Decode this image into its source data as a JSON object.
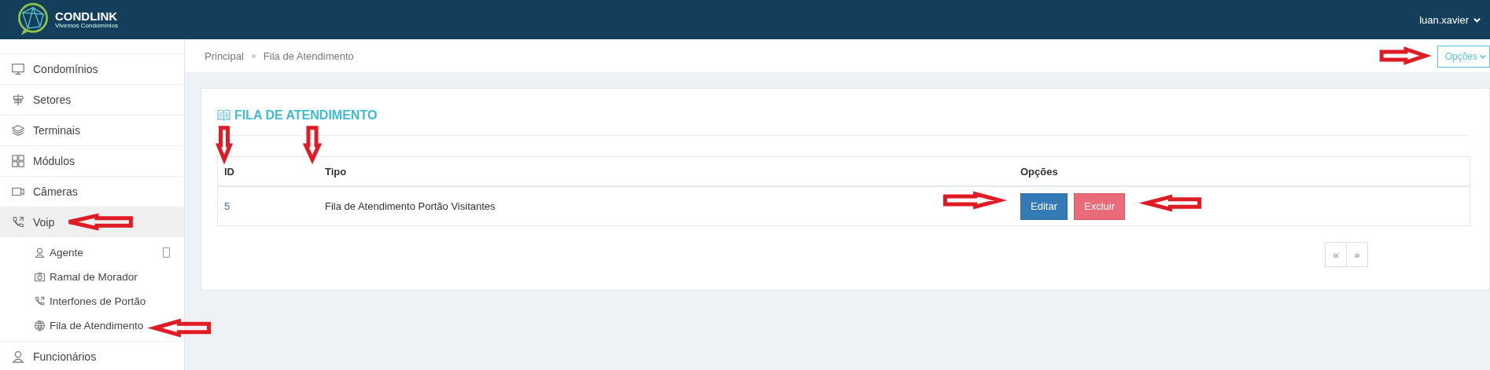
{
  "header": {
    "brand": "CONDLINK",
    "tagline": "Vivemos Condomínios",
    "user": "luan.xavier"
  },
  "sidebar": {
    "items": [
      {
        "label": "Condomínios",
        "kind": "monitor",
        "selected": false
      },
      {
        "label": "Setores",
        "kind": "sign",
        "selected": false
      },
      {
        "label": "Terminais",
        "kind": "layers",
        "selected": false
      },
      {
        "label": "Módulos",
        "kind": "grid",
        "selected": false
      },
      {
        "label": "Câmeras",
        "kind": "camera",
        "selected": false
      },
      {
        "label": "Voip",
        "kind": "phone",
        "selected": true,
        "children": [
          {
            "label": "Agente",
            "kind": "user"
          },
          {
            "label": "Ramal de Morador",
            "kind": "photo"
          },
          {
            "label": "Interfones de Portão",
            "kind": "phone"
          },
          {
            "label": "Fila de Atendimento",
            "kind": "globe"
          }
        ]
      },
      {
        "label": "Funcionários",
        "kind": "user",
        "selected": false
      }
    ]
  },
  "breadcrumb": [
    "Principal",
    "Fila de Atendimento"
  ],
  "options_button": "Opções",
  "panel": {
    "title": "FILA DE ATENDIMENTO",
    "table": {
      "columns": [
        "ID",
        "Tipo",
        "Opções"
      ],
      "rows": [
        {
          "id": "5",
          "tipo": "Fila de Atendimento Portão Visitantes",
          "actions": [
            "Editar",
            "Excluir"
          ]
        }
      ]
    },
    "pagination": [
      "«",
      "»"
    ]
  }
}
